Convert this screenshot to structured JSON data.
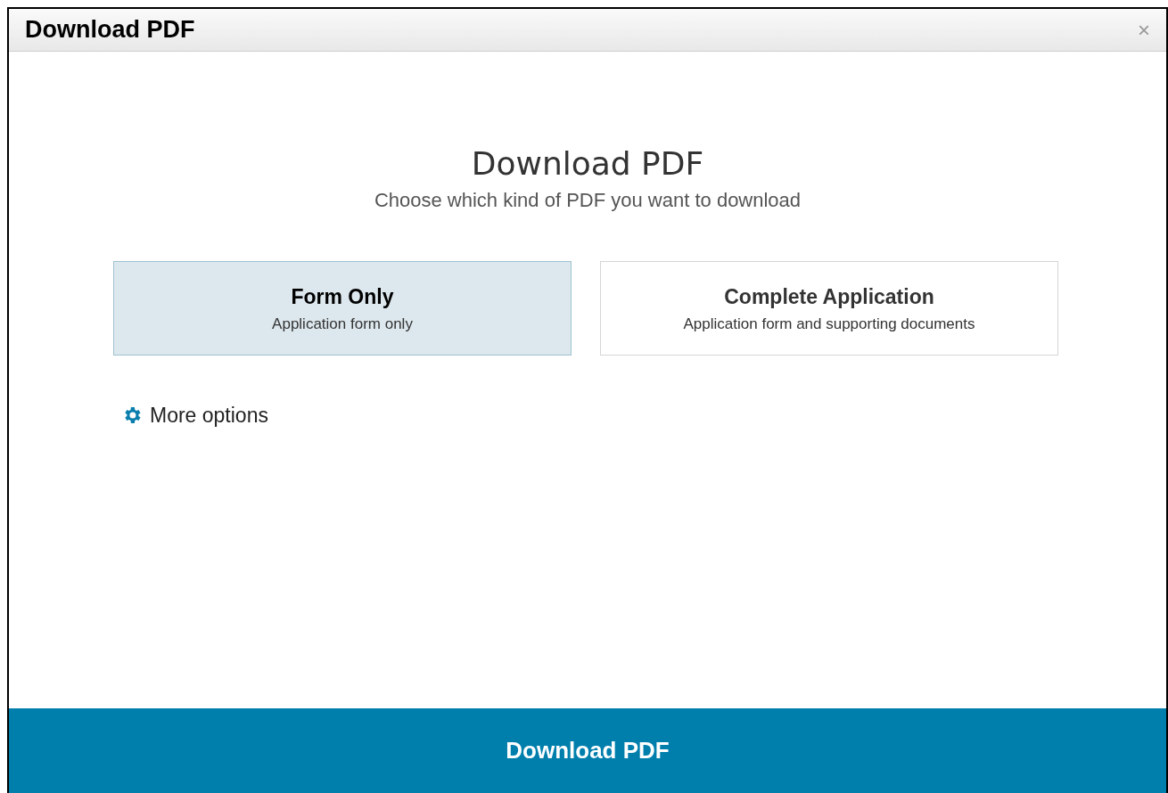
{
  "dialog": {
    "title": "Download PDF",
    "close": "×"
  },
  "heading": "Download PDF",
  "subtitle": "Choose which kind of PDF you want to download",
  "options": [
    {
      "title": "Form Only",
      "description": "Application form only",
      "selected": true
    },
    {
      "title": "Complete Application",
      "description": "Application form and supporting documents",
      "selected": false
    }
  ],
  "more_options": "More options",
  "download_button": "Download PDF"
}
